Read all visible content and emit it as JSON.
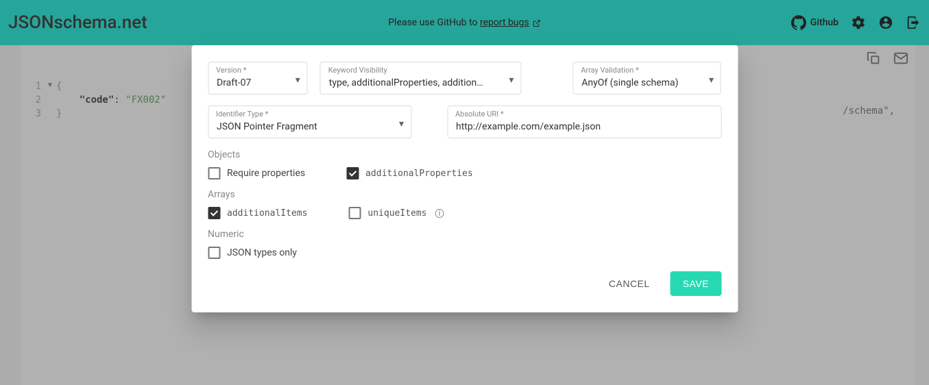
{
  "header": {
    "logo": "JSONschema.net",
    "banner_text": "Please use GitHub to ",
    "banner_link": "report bugs",
    "github": "Github"
  },
  "editor": {
    "lines": [
      "1",
      "2",
      "3"
    ],
    "code_brace_open": "{",
    "code_key": "\"code\"",
    "code_colon": ": ",
    "code_value": "\"FX002\"",
    "code_brace_close": "}",
    "right_snippet": "/schema\","
  },
  "dialog": {
    "version_label": "Version *",
    "version_value": "Draft-07",
    "keyword_label": "Keyword Visibility",
    "keyword_value": "type, additionalProperties, addition…",
    "arrayval_label": "Array Validation *",
    "arrayval_value": "AnyOf (single schema)",
    "idtype_label": "Identifier Type *",
    "idtype_value": "JSON Pointer Fragment",
    "absuri_label": "Absolute URI *",
    "absuri_value": "http://example.com/example.json",
    "objects_title": "Objects",
    "req_prop": "Require properties",
    "add_prop": "additionalProperties",
    "arrays_title": "Arrays",
    "add_items": "additionalItems",
    "unique_items": "uniqueItems",
    "numeric_title": "Numeric",
    "json_types": "JSON types only",
    "cancel": "CANCEL",
    "save": "SAVE"
  }
}
